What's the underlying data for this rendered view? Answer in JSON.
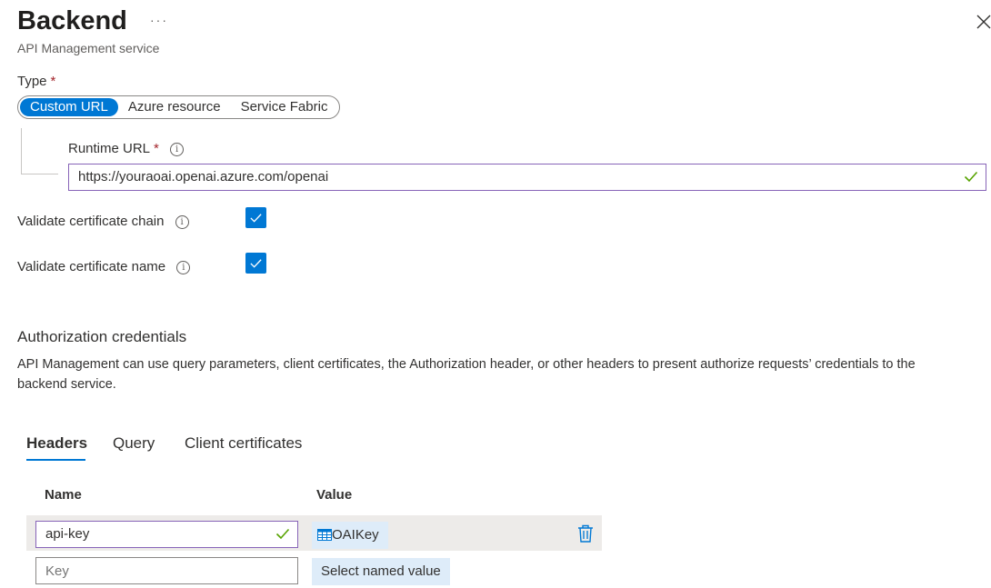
{
  "header": {
    "title": "Backend",
    "more_label": "···",
    "subtitle": "API Management service"
  },
  "type_field": {
    "label": "Type",
    "required_mark": "*",
    "options": [
      "Custom URL",
      "Azure resource",
      "Service Fabric"
    ],
    "selected": "Custom URL"
  },
  "runtime_url": {
    "label": "Runtime URL",
    "required_mark": "*",
    "value": "https://youraoai.openai.azure.com/openai"
  },
  "validate_chain": {
    "label": "Validate certificate chain",
    "checked": true
  },
  "validate_name": {
    "label": "Validate certificate name",
    "checked": true
  },
  "auth": {
    "title": "Authorization credentials",
    "description": "API Management can use query parameters, client certificates, the Authorization header, or other headers to present authorize requests’ credentials to the backend service."
  },
  "tabs": [
    "Headers",
    "Query",
    "Client certificates"
  ],
  "active_tab": "Headers",
  "headers_table": {
    "columns": [
      "Name",
      "Value"
    ],
    "rows": [
      {
        "name": "api-key",
        "value": "OAIKey"
      }
    ],
    "new_row": {
      "name_placeholder": "Key",
      "value_button": "Select named value"
    }
  },
  "colors": {
    "accent": "#0078d4",
    "valid_border": "#8764b8",
    "success_check": "#57a300",
    "required": "#a4262c",
    "row_highlight": "#edebe9",
    "pill_bg": "#deecf9"
  },
  "icons": {
    "info": "info-icon",
    "close": "close-icon",
    "checkmark": "checkmark-icon",
    "delete": "trash-icon",
    "named_value": "table-icon"
  }
}
